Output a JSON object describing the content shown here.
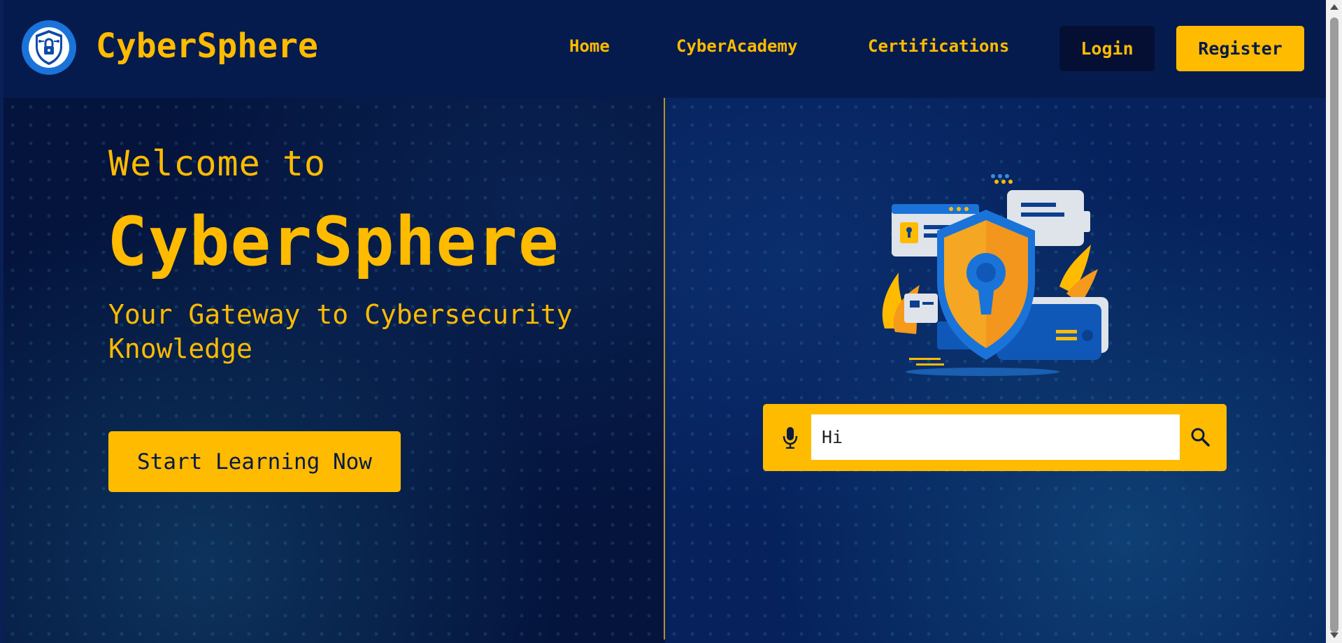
{
  "header": {
    "brand": "CyberSphere",
    "nav": [
      {
        "label": "Home"
      },
      {
        "label": "CyberAcademy"
      },
      {
        "label": "Certifications"
      }
    ],
    "login_label": "Login",
    "register_label": "Register"
  },
  "hero": {
    "welcome": "Welcome to",
    "title": "CyberSphere",
    "tagline_line1": "Your Gateway to Cybersecurity",
    "tagline_line2": "Knowledge",
    "cta_label": "Start Learning Now"
  },
  "search": {
    "value": "Hi",
    "mic_icon": "microphone-icon",
    "search_icon": "search-icon"
  },
  "colors": {
    "accent": "#ffbb00",
    "background": "#06194a",
    "logo_blue": "#1a73d9"
  }
}
